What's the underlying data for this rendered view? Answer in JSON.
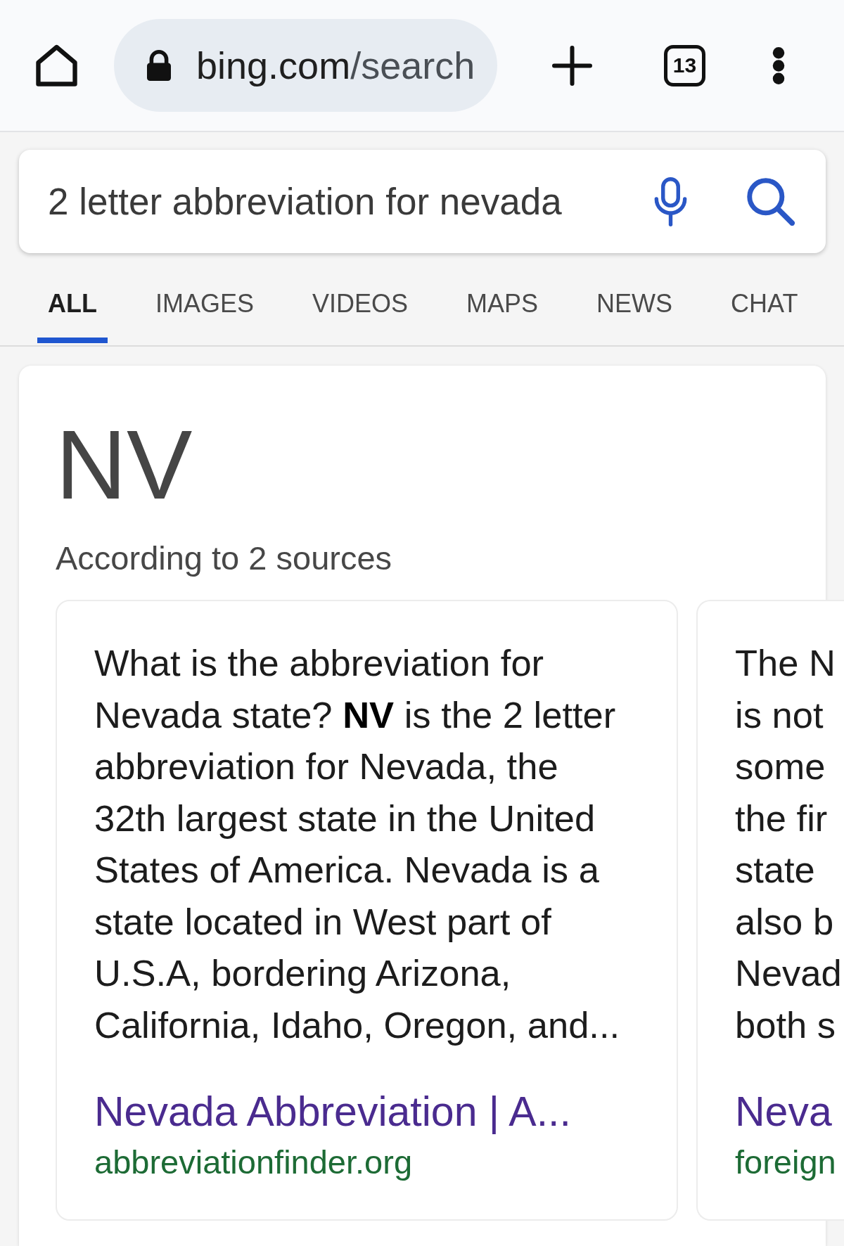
{
  "browser_bar": {
    "url": {
      "host": "bing.com",
      "path": "/search"
    },
    "tab_count": "13"
  },
  "search": {
    "query": "2 letter abbreviation for nevada"
  },
  "tabs": [
    {
      "label": "ALL",
      "selected": true
    },
    {
      "label": "IMAGES",
      "selected": false
    },
    {
      "label": "VIDEOS",
      "selected": false
    },
    {
      "label": "MAPS",
      "selected": false
    },
    {
      "label": "NEWS",
      "selected": false
    },
    {
      "label": "CHAT",
      "selected": false
    }
  ],
  "answer": {
    "title": "NV",
    "subtitle": "According to 2 sources",
    "sources": [
      {
        "kind": "full",
        "text": "What is the abbreviation for Nevada state? **NV** is the 2 letter abbreviation for Nevada, the 32th largest state in the United States of America. Nevada is a state located in West part of U.S.A, bordering Arizona, California, Idaho, Oregon, and...",
        "link_title": "Nevada Abbreviation | A...",
        "domain": "abbreviationfinder.org"
      },
      {
        "kind": "clipped",
        "lines": [
          "The N",
          "is not",
          "some",
          "the fir",
          "state",
          "also b",
          "Nevad",
          "both s"
        ],
        "link_title": "Neva",
        "domain": "foreign"
      }
    ]
  }
}
